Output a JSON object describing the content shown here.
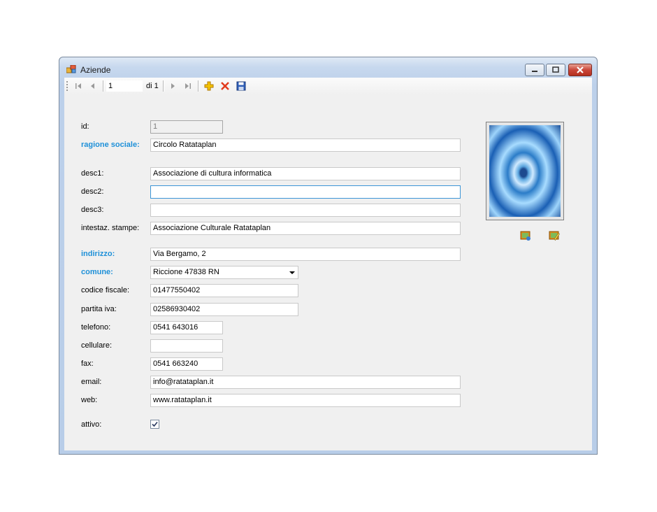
{
  "window": {
    "title": "Aziende",
    "icon": "app-window-icon"
  },
  "navigator": {
    "position": "1",
    "of_label": "di 1",
    "buttons": [
      "move-first-icon",
      "move-prev-icon",
      "move-next-icon",
      "move-last-icon",
      "add-new-icon",
      "delete-icon",
      "save-icon"
    ]
  },
  "form": {
    "id": {
      "label": "id:",
      "value": "1"
    },
    "ragione_sociale": {
      "label": "ragione sociale:",
      "value": "Circolo Ratataplan"
    },
    "desc1": {
      "label": "desc1:",
      "value": "Associazione di cultura informatica"
    },
    "desc2": {
      "label": "desc2:",
      "value": ""
    },
    "desc3": {
      "label": "desc3:",
      "value": ""
    },
    "intestazione": {
      "label": "intestaz. stampe:",
      "value": "Associazione Culturale Ratataplan"
    },
    "indirizzo": {
      "label": "indirizzo:",
      "value": "Via Bergamo, 2"
    },
    "comune": {
      "label": "comune:",
      "value": "Riccione 47838 RN"
    },
    "codice_fiscale": {
      "label": "codice fiscale:",
      "value": "01477550402"
    },
    "partita_iva": {
      "label": "partita iva:",
      "value": "02586930402"
    },
    "telefono": {
      "label": "telefono:",
      "value": "0541 643016"
    },
    "cellulare": {
      "label": "cellulare:",
      "value": ""
    },
    "fax": {
      "label": "fax:",
      "value": "0541 663240"
    },
    "email": {
      "label": "email:",
      "value": "info@ratataplan.it"
    },
    "web": {
      "label": "web:",
      "value": "www.ratataplan.it"
    },
    "attivo": {
      "label": "attivo:",
      "checked": true
    }
  },
  "image_buttons": [
    "load-image-icon",
    "edit-image-icon"
  ],
  "colors": {
    "required_label": "#1e90d8",
    "focus_border": "#3d95d6"
  }
}
